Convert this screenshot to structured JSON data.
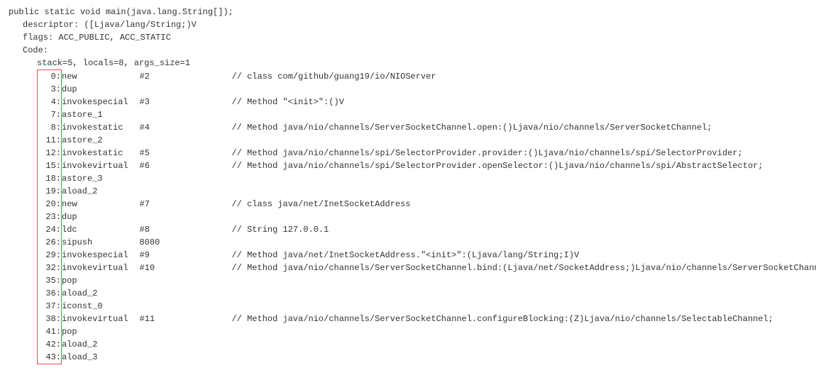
{
  "header": {
    "signature": "public static void main(java.lang.String[]);",
    "descriptor": "descriptor: ([Ljava/lang/String;)V",
    "flags": "flags: ACC_PUBLIC, ACC_STATIC",
    "code_label": "Code:",
    "stack_line": "stack=5, locals=8, args_size=1"
  },
  "rows": [
    {
      "offset": "0:",
      "instr": "new",
      "arg": "#2",
      "comment": "// class com/github/guang19/io/NIOServer"
    },
    {
      "offset": "3:",
      "instr": "dup",
      "arg": "",
      "comment": ""
    },
    {
      "offset": "4:",
      "instr": "invokespecial",
      "arg": "#3",
      "comment": "// Method \"<init>\":()V"
    },
    {
      "offset": "7:",
      "instr": "astore_1",
      "arg": "",
      "comment": ""
    },
    {
      "offset": "8:",
      "instr": "invokestatic",
      "arg": "#4",
      "comment": "// Method java/nio/channels/ServerSocketChannel.open:()Ljava/nio/channels/ServerSocketChannel;"
    },
    {
      "offset": "11:",
      "instr": "astore_2",
      "arg": "",
      "comment": ""
    },
    {
      "offset": "12:",
      "instr": "invokestatic",
      "arg": "#5",
      "comment": "// Method java/nio/channels/spi/SelectorProvider.provider:()Ljava/nio/channels/spi/SelectorProvider;"
    },
    {
      "offset": "15:",
      "instr": "invokevirtual",
      "arg": "#6",
      "comment": "// Method java/nio/channels/spi/SelectorProvider.openSelector:()Ljava/nio/channels/spi/AbstractSelector;"
    },
    {
      "offset": "18:",
      "instr": "astore_3",
      "arg": "",
      "comment": ""
    },
    {
      "offset": "19:",
      "instr": "aload_2",
      "arg": "",
      "comment": ""
    },
    {
      "offset": "20:",
      "instr": "new",
      "arg": "#7",
      "comment": "// class java/net/InetSocketAddress"
    },
    {
      "offset": "23:",
      "instr": "dup",
      "arg": "",
      "comment": ""
    },
    {
      "offset": "24:",
      "instr": "ldc",
      "arg": "#8",
      "comment": "// String 127.0.0.1"
    },
    {
      "offset": "26:",
      "instr": "sipush",
      "arg": "8080",
      "comment": ""
    },
    {
      "offset": "29:",
      "instr": "invokespecial",
      "arg": "#9",
      "comment": "// Method java/net/InetSocketAddress.\"<init>\":(Ljava/lang/String;I)V"
    },
    {
      "offset": "32:",
      "instr": "invokevirtual",
      "arg": "#10",
      "comment": "// Method java/nio/channels/ServerSocketChannel.bind:(Ljava/net/SocketAddress;)Ljava/nio/channels/ServerSocketChannel"
    },
    {
      "offset": "35:",
      "instr": "pop",
      "arg": "",
      "comment": ""
    },
    {
      "offset": "36:",
      "instr": "aload_2",
      "arg": "",
      "comment": ""
    },
    {
      "offset": "37:",
      "instr": "iconst_0",
      "arg": "",
      "comment": ""
    },
    {
      "offset": "38:",
      "instr": "invokevirtual",
      "arg": "#11",
      "comment": "// Method java/nio/channels/ServerSocketChannel.configureBlocking:(Z)Ljava/nio/channels/SelectableChannel;"
    },
    {
      "offset": "41:",
      "instr": "pop",
      "arg": "",
      "comment": ""
    },
    {
      "offset": "42:",
      "instr": "aload_2",
      "arg": "",
      "comment": ""
    },
    {
      "offset": "43:",
      "instr": "aload_3",
      "arg": "",
      "comment": ""
    }
  ]
}
